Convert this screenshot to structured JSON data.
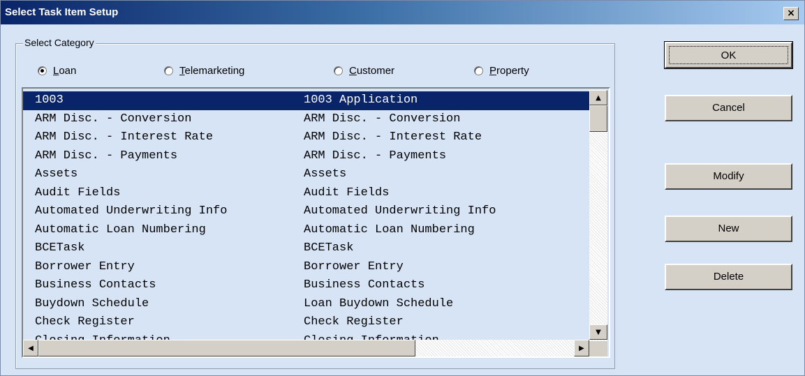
{
  "window": {
    "title": "Select Task Item Setup",
    "close_label": "×"
  },
  "group": {
    "legend": "Select Category",
    "radios": [
      {
        "label": "Loan",
        "accel": "L",
        "rest": "oan",
        "checked": true
      },
      {
        "label": "Telemarketing",
        "accel": "T",
        "rest": "elemarketing",
        "checked": false
      },
      {
        "label": "Customer",
        "accel": "C",
        "rest": "ustomer",
        "checked": false
      },
      {
        "label": "Property",
        "accel": "P",
        "rest": "roperty",
        "checked": false
      }
    ]
  },
  "list": {
    "rows": [
      {
        "name": "1003",
        "description": "1003 Application",
        "selected": true
      },
      {
        "name": "ARM Disc. - Conversion",
        "description": "ARM Disc. - Conversion"
      },
      {
        "name": "ARM Disc. - Interest Rate",
        "description": "ARM Disc. - Interest Rate"
      },
      {
        "name": "ARM Disc. - Payments",
        "description": "ARM Disc. - Payments"
      },
      {
        "name": "Assets",
        "description": "Assets"
      },
      {
        "name": "Audit Fields",
        "description": "Audit Fields"
      },
      {
        "name": "Automated Underwriting Info",
        "description": "Automated Underwriting Info"
      },
      {
        "name": "Automatic Loan Numbering",
        "description": "Automatic Loan Numbering"
      },
      {
        "name": "BCETask",
        "description": "BCETask"
      },
      {
        "name": "Borrower Entry",
        "description": "Borrower Entry"
      },
      {
        "name": "Business Contacts",
        "description": "Business Contacts"
      },
      {
        "name": "Buydown Schedule",
        "description": "Loan Buydown Schedule"
      },
      {
        "name": "Check Register",
        "description": "Check Register"
      },
      {
        "name": "Closing Information",
        "description": "Closing Information"
      }
    ]
  },
  "buttons": {
    "ok": "OK",
    "cancel": "Cancel",
    "modify": "Modify",
    "new": "New",
    "delete": "Delete"
  }
}
